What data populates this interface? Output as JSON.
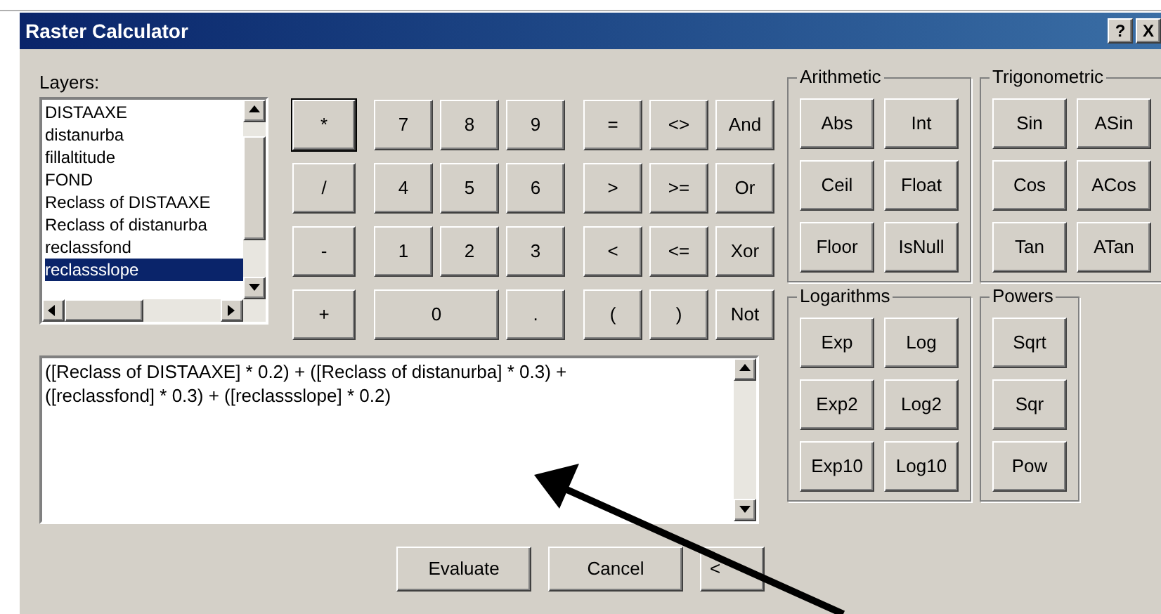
{
  "window": {
    "title": "Raster Calculator",
    "title_buttons": [
      "?",
      "X"
    ]
  },
  "layers": {
    "label": "Layers:",
    "items": [
      {
        "label": "DISTAAXE",
        "selected": false
      },
      {
        "label": "distanurba",
        "selected": false
      },
      {
        "label": "fillaltitude",
        "selected": false
      },
      {
        "label": "FOND",
        "selected": false
      },
      {
        "label": "Reclass of DISTAAXE",
        "selected": false
      },
      {
        "label": "Reclass of distanurba",
        "selected": false
      },
      {
        "label": "reclassfond",
        "selected": false
      },
      {
        "label": "reclassslope",
        "selected": true
      }
    ]
  },
  "operators": [
    {
      "label": "*",
      "focused": true
    },
    {
      "label": "/",
      "focused": false
    },
    {
      "label": "-",
      "focused": false
    },
    {
      "label": "+",
      "focused": false
    }
  ],
  "numbers": [
    {
      "label": "7",
      "kind": "normal"
    },
    {
      "label": "8",
      "kind": "normal"
    },
    {
      "label": "9",
      "kind": "normal"
    },
    {
      "label": "4",
      "kind": "normal"
    },
    {
      "label": "5",
      "kind": "normal"
    },
    {
      "label": "6",
      "kind": "normal"
    },
    {
      "label": "1",
      "kind": "normal"
    },
    {
      "label": "2",
      "kind": "normal"
    },
    {
      "label": "3",
      "kind": "normal"
    },
    {
      "label": "0",
      "kind": "wide"
    },
    {
      "label": ".",
      "kind": "normal"
    }
  ],
  "comparisons": [
    "=",
    "<>",
    "And",
    ">",
    ">=",
    "Or",
    "<",
    "<=",
    "Xor",
    "(",
    ")",
    "Not"
  ],
  "function_groups": [
    {
      "title": "Arithmetic",
      "buttons": [
        "Abs",
        "Int",
        "Ceil",
        "Float",
        "Floor",
        "IsNull"
      ]
    },
    {
      "title": "Trigonometric",
      "buttons": [
        "Sin",
        "ASin",
        "Cos",
        "ACos",
        "Tan",
        "ATan"
      ]
    },
    {
      "title": "Logarithms",
      "buttons": [
        "Exp",
        "Log",
        "Exp2",
        "Log2",
        "Exp10",
        "Log10"
      ]
    },
    {
      "title": "Powers",
      "buttons": [
        "Sqrt",
        "Sqr",
        "Pow"
      ]
    }
  ],
  "expression": {
    "value": "([Reclass of DISTAAXE] * 0.2) + ([Reclass of distanurba] * 0.3) + ([reclassfond] * 0.3) + ([reclassslope] * 0.2)"
  },
  "footer_buttons": [
    "Evaluate",
    "Cancel",
    "<"
  ]
}
